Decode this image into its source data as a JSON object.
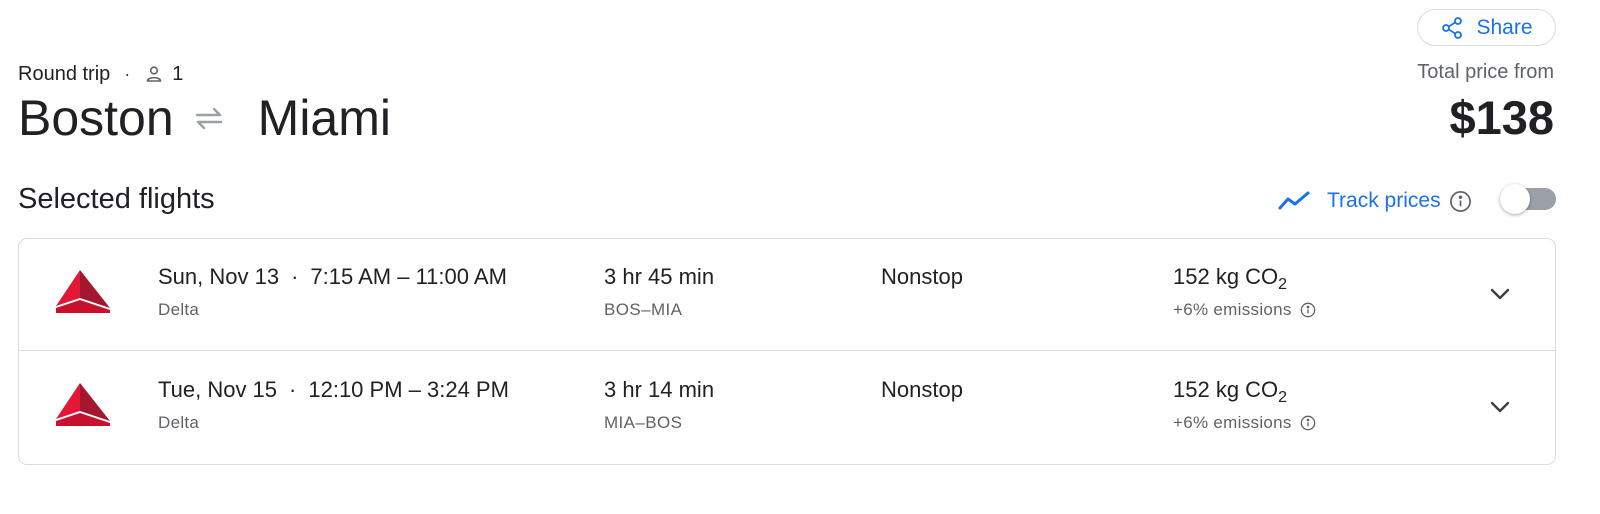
{
  "header": {
    "share_label": "Share",
    "trip_type": "Round trip",
    "passengers": "1",
    "origin": "Boston",
    "destination": "Miami",
    "price_label": "Total price from",
    "price": "$138"
  },
  "section": {
    "title": "Selected flights",
    "track_prices_label": "Track prices",
    "track_prices_enabled": false
  },
  "colors": {
    "accent": "#1a73e8",
    "delta_red_light": "#e31837",
    "delta_red_dark": "#a3172f"
  },
  "flights": [
    {
      "date": "Sun, Nov 13",
      "time_range": "7:15 AM – 11:00 AM",
      "airline": "Delta",
      "duration": "3 hr 45 min",
      "route": "BOS–MIA",
      "stops": "Nonstop",
      "co2_value": "152 kg CO",
      "co2_sub": "2",
      "emissions": "+6% emissions"
    },
    {
      "date": "Tue, Nov 15",
      "time_range": "12:10 PM – 3:24 PM",
      "airline": "Delta",
      "duration": "3 hr 14 min",
      "route": "MIA–BOS",
      "stops": "Nonstop",
      "co2_value": "152 kg CO",
      "co2_sub": "2",
      "emissions": "+6% emissions"
    }
  ],
  "icons": {
    "share": "share-icon",
    "person": "person-icon",
    "swap": "swap-arrows-icon",
    "trend": "trend-line-icon",
    "info": "info-icon",
    "chevron": "chevron-down-icon",
    "airline_logo": "delta-logo"
  }
}
